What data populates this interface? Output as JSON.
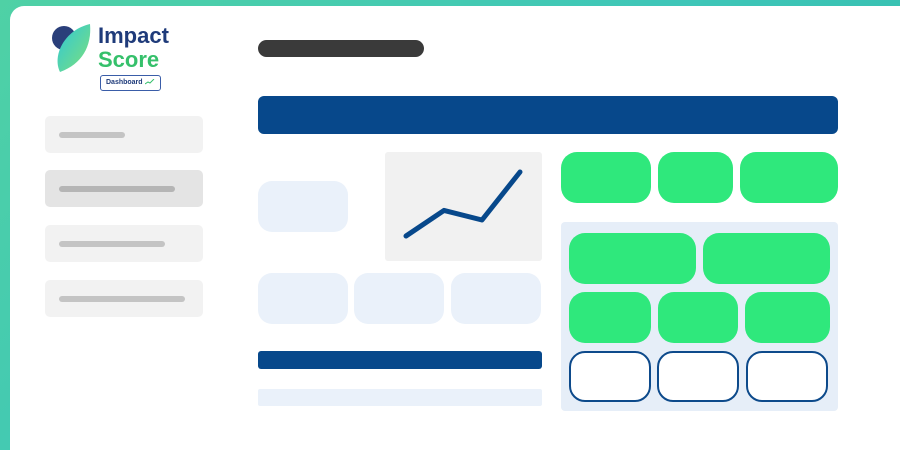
{
  "logo": {
    "title": "Impact",
    "subtitle": "Score",
    "badge": "Dashboard",
    "leaf_icon": "leaf-icon",
    "trend_icon": "trend-arrow-icon"
  },
  "colors": {
    "navy": "#07488b",
    "green": "#2fe87c",
    "light_blue": "#eaf1fa",
    "sidebar_gray": "#f2f2f2",
    "dark_pill": "#3a3a3a",
    "background_teal": "#3ec6b8"
  },
  "sidebar": {
    "items": [
      {
        "name": "sidebar-item-1",
        "active": false
      },
      {
        "name": "sidebar-item-2",
        "active": true
      },
      {
        "name": "sidebar-item-3",
        "active": false
      },
      {
        "name": "sidebar-item-4",
        "active": false
      }
    ]
  },
  "chart_data": {
    "type": "line",
    "x": [
      0,
      1,
      2,
      3
    ],
    "values": [
      0,
      0.4,
      0.25,
      1
    ],
    "series": [
      {
        "values": [
          0,
          0.4,
          0.25,
          1
        ]
      }
    ]
  }
}
